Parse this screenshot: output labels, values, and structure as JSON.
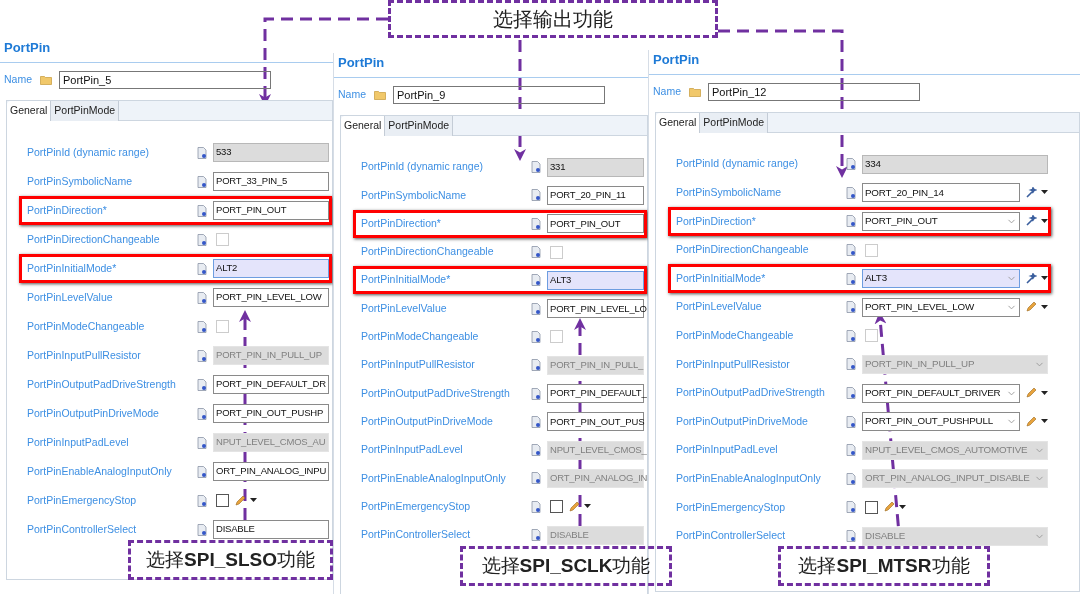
{
  "panels": [
    {
      "title": "PortPin",
      "name_label": "Name",
      "name_value": "PortPin_5",
      "tabs": [
        {
          "label": "General",
          "selected": true
        },
        {
          "label": "PortPinMode",
          "selected": false
        }
      ],
      "rows": [
        {
          "label": "PortPinId (dynamic range)",
          "kind": "readonly",
          "value": "533",
          "disabled": false,
          "focused": false,
          "marked": false
        },
        {
          "label": "PortPinSymbolicName",
          "kind": "text",
          "value": "PORT_33_PIN_5",
          "disabled": false,
          "focused": false,
          "marked": false
        },
        {
          "label": "PortPinDirection*",
          "kind": "text",
          "value": "PORT_PIN_OUT",
          "disabled": false,
          "focused": false,
          "marked": true
        },
        {
          "label": "PortPinDirectionChangeable",
          "kind": "checkbox",
          "checked": false,
          "marked": false
        },
        {
          "label": "PortPinInitialMode*",
          "kind": "text",
          "value": "ALT2",
          "disabled": false,
          "focused": true,
          "marked": true
        },
        {
          "label": "PortPinLevelValue",
          "kind": "text",
          "value": "PORT_PIN_LEVEL_LOW",
          "disabled": false,
          "focused": false,
          "marked": false
        },
        {
          "label": "PortPinModeChangeable",
          "kind": "checkbox",
          "checked": false,
          "marked": false
        },
        {
          "label": "PortPinInputPullResistor",
          "kind": "text",
          "value": "PORT_PIN_IN_PULL_UP",
          "disabled": true,
          "focused": false,
          "marked": false
        },
        {
          "label": "PortPinOutputPadDriveStrength",
          "kind": "text",
          "value": "PORT_PIN_DEFAULT_DR",
          "disabled": false,
          "focused": false,
          "marked": false
        },
        {
          "label": "PortPinOutputPinDriveMode",
          "kind": "text",
          "value": "PORT_PIN_OUT_PUSHP",
          "disabled": false,
          "focused": false,
          "marked": false
        },
        {
          "label": "PortPinInputPadLevel",
          "kind": "text",
          "value": "NPUT_LEVEL_CMOS_AU",
          "disabled": true,
          "focused": false,
          "marked": false
        },
        {
          "label": "PortPinEnableAnalogInputOnly",
          "kind": "text",
          "value": "ORT_PIN_ANALOG_INPU",
          "disabled": false,
          "focused": false,
          "marked": false
        },
        {
          "label": "PortPinEmergencyStop",
          "kind": "checkbox",
          "checked": false,
          "marked": false,
          "tool": {
            "kind": "pencil"
          }
        },
        {
          "label": "PortPinControllerSelect",
          "kind": "text",
          "value": "DISABLE",
          "disabled": false,
          "focused": false,
          "marked": false
        }
      ]
    },
    {
      "title": "PortPin",
      "name_label": "Name",
      "name_value": "PortPin_9",
      "tabs": [
        {
          "label": "General",
          "selected": true
        },
        {
          "label": "PortPinMode",
          "selected": false
        }
      ],
      "rows": [
        {
          "label": "PortPinId (dynamic range)",
          "kind": "readonly",
          "value": "331",
          "disabled": false,
          "focused": false,
          "marked": false
        },
        {
          "label": "PortPinSymbolicName",
          "kind": "text",
          "value": "PORT_20_PIN_11",
          "disabled": false,
          "focused": false,
          "marked": false
        },
        {
          "label": "PortPinDirection*",
          "kind": "text",
          "value": "PORT_PIN_OUT",
          "disabled": false,
          "focused": false,
          "marked": true
        },
        {
          "label": "PortPinDirectionChangeable",
          "kind": "checkbox",
          "checked": false,
          "marked": false
        },
        {
          "label": "PortPinInitialMode*",
          "kind": "text",
          "value": "ALT3",
          "disabled": false,
          "focused": true,
          "marked": true
        },
        {
          "label": "PortPinLevelValue",
          "kind": "text",
          "value": "PORT_PIN_LEVEL_LO",
          "disabled": false,
          "focused": false,
          "marked": false
        },
        {
          "label": "PortPinModeChangeable",
          "kind": "checkbox",
          "checked": false,
          "marked": false
        },
        {
          "label": "PortPinInputPullResistor",
          "kind": "text",
          "value": "PORT_PIN_IN_PULL_",
          "disabled": true,
          "focused": false,
          "marked": false
        },
        {
          "label": "PortPinOutputPadDriveStrength",
          "kind": "text",
          "value": "PORT_PIN_DEFAULT_",
          "disabled": false,
          "focused": false,
          "marked": false
        },
        {
          "label": "PortPinOutputPinDriveMode",
          "kind": "text",
          "value": "PORT_PIN_OUT_PUS",
          "disabled": false,
          "focused": false,
          "marked": false
        },
        {
          "label": "PortPinInputPadLevel",
          "kind": "text",
          "value": "NPUT_LEVEL_CMOS_",
          "disabled": true,
          "focused": false,
          "marked": false
        },
        {
          "label": "PortPinEnableAnalogInputOnly",
          "kind": "text",
          "value": "ORT_PIN_ANALOG_IN",
          "disabled": true,
          "focused": false,
          "marked": false
        },
        {
          "label": "PortPinEmergencyStop",
          "kind": "checkbox",
          "checked": false,
          "marked": false,
          "tool": {
            "kind": "pencil"
          }
        },
        {
          "label": "PortPinControllerSelect",
          "kind": "text",
          "value": "DISABLE",
          "disabled": true,
          "focused": false,
          "marked": false
        }
      ]
    },
    {
      "title": "PortPin",
      "name_label": "Name",
      "name_value": "PortPin_12",
      "tabs": [
        {
          "label": "General",
          "selected": true
        },
        {
          "label": "PortPinMode",
          "selected": false
        }
      ],
      "rows": [
        {
          "label": "PortPinId (dynamic range)",
          "kind": "readonly",
          "value": "334",
          "disabled": false,
          "focused": false,
          "marked": false
        },
        {
          "label": "PortPinSymbolicName",
          "kind": "text",
          "value": "PORT_20_PIN_14",
          "disabled": false,
          "focused": false,
          "marked": false,
          "tool": {
            "kind": "wand"
          }
        },
        {
          "label": "PortPinDirection*",
          "kind": "combo",
          "value": "PORT_PIN_OUT",
          "disabled": false,
          "focused": false,
          "marked": true,
          "tool": {
            "kind": "wand"
          }
        },
        {
          "label": "PortPinDirectionChangeable",
          "kind": "checkbox",
          "checked": false,
          "marked": false
        },
        {
          "label": "PortPinInitialMode*",
          "kind": "combo",
          "value": "ALT3",
          "disabled": false,
          "focused": true,
          "marked": true,
          "tool": {
            "kind": "wand"
          }
        },
        {
          "label": "PortPinLevelValue",
          "kind": "combo",
          "value": "PORT_PIN_LEVEL_LOW",
          "disabled": false,
          "focused": false,
          "marked": false,
          "tool": {
            "kind": "pencil"
          }
        },
        {
          "label": "PortPinModeChangeable",
          "kind": "checkbox",
          "checked": false,
          "marked": false
        },
        {
          "label": "PortPinInputPullResistor",
          "kind": "combo",
          "value": "PORT_PIN_IN_PULL_UP",
          "disabled": true,
          "focused": false,
          "marked": false
        },
        {
          "label": "PortPinOutputPadDriveStrength",
          "kind": "combo",
          "value": "PORT_PIN_DEFAULT_DRIVER",
          "disabled": false,
          "focused": false,
          "marked": false,
          "tool": {
            "kind": "pencil"
          }
        },
        {
          "label": "PortPinOutputPinDriveMode",
          "kind": "combo",
          "value": "PORT_PIN_OUT_PUSHPULL",
          "disabled": false,
          "focused": false,
          "marked": false,
          "tool": {
            "kind": "pencil"
          }
        },
        {
          "label": "PortPinInputPadLevel",
          "kind": "combo",
          "value": "NPUT_LEVEL_CMOS_AUTOMOTIVE",
          "disabled": true,
          "focused": false,
          "marked": false
        },
        {
          "label": "PortPinEnableAnalogInputOnly",
          "kind": "combo",
          "value": "ORT_PIN_ANALOG_INPUT_DISABLE",
          "disabled": true,
          "focused": false,
          "marked": false
        },
        {
          "label": "PortPinEmergencyStop",
          "kind": "checkbox",
          "checked": false,
          "marked": false,
          "tool": {
            "kind": "pencil"
          }
        },
        {
          "label": "PortPinControllerSelect",
          "kind": "combo",
          "value": "DISABLE",
          "disabled": true,
          "focused": false,
          "marked": false
        }
      ]
    }
  ],
  "callouts": [
    {
      "text": "选择输出功能"
    },
    {
      "text": "选择**SPI_SLSO**功能"
    },
    {
      "text": "选择**SPI_SCLK**功能"
    },
    {
      "text": "选择**SPI_MTSR**功能"
    }
  ]
}
